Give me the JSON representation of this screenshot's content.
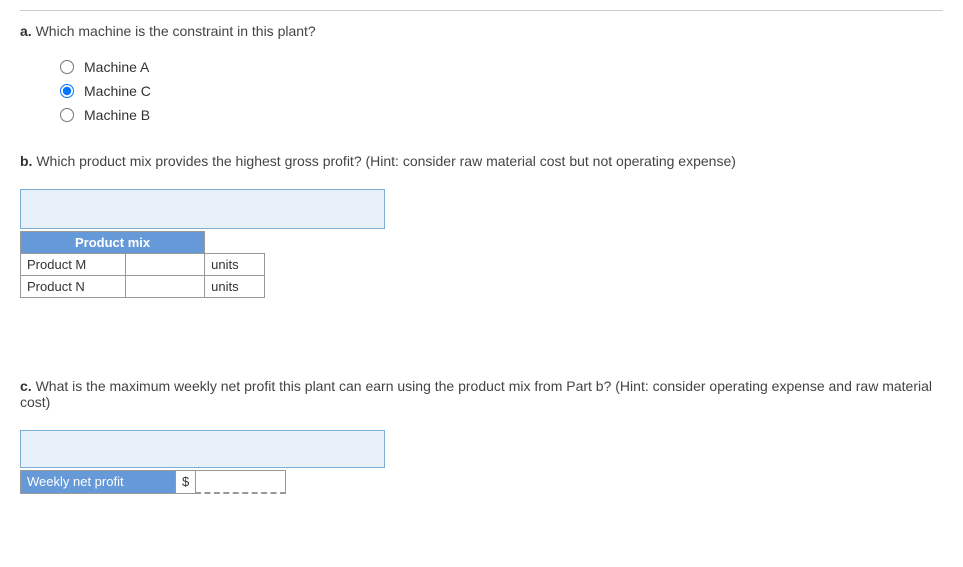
{
  "question_a": {
    "prefix": "a.",
    "text": "Which machine is the constraint in this plant?",
    "options": [
      {
        "label": "Machine A",
        "checked": false
      },
      {
        "label": "Machine C",
        "checked": true
      },
      {
        "label": "Machine B",
        "checked": false
      }
    ]
  },
  "question_b": {
    "prefix": "b.",
    "text": "Which product mix provides the highest gross profit? (Hint: consider raw material cost but not operating expense)",
    "table_header": "Product mix",
    "rows": [
      {
        "label": "Product M",
        "value": "",
        "unit": "units"
      },
      {
        "label": "Product N",
        "value": "",
        "unit": "units"
      }
    ]
  },
  "question_c": {
    "prefix": "c.",
    "text": "What is the maximum weekly net profit this plant can earn using the product mix from Part b? (Hint: consider operating expense and raw material cost)",
    "row_label": "Weekly net profit",
    "currency": "$",
    "value": ""
  }
}
